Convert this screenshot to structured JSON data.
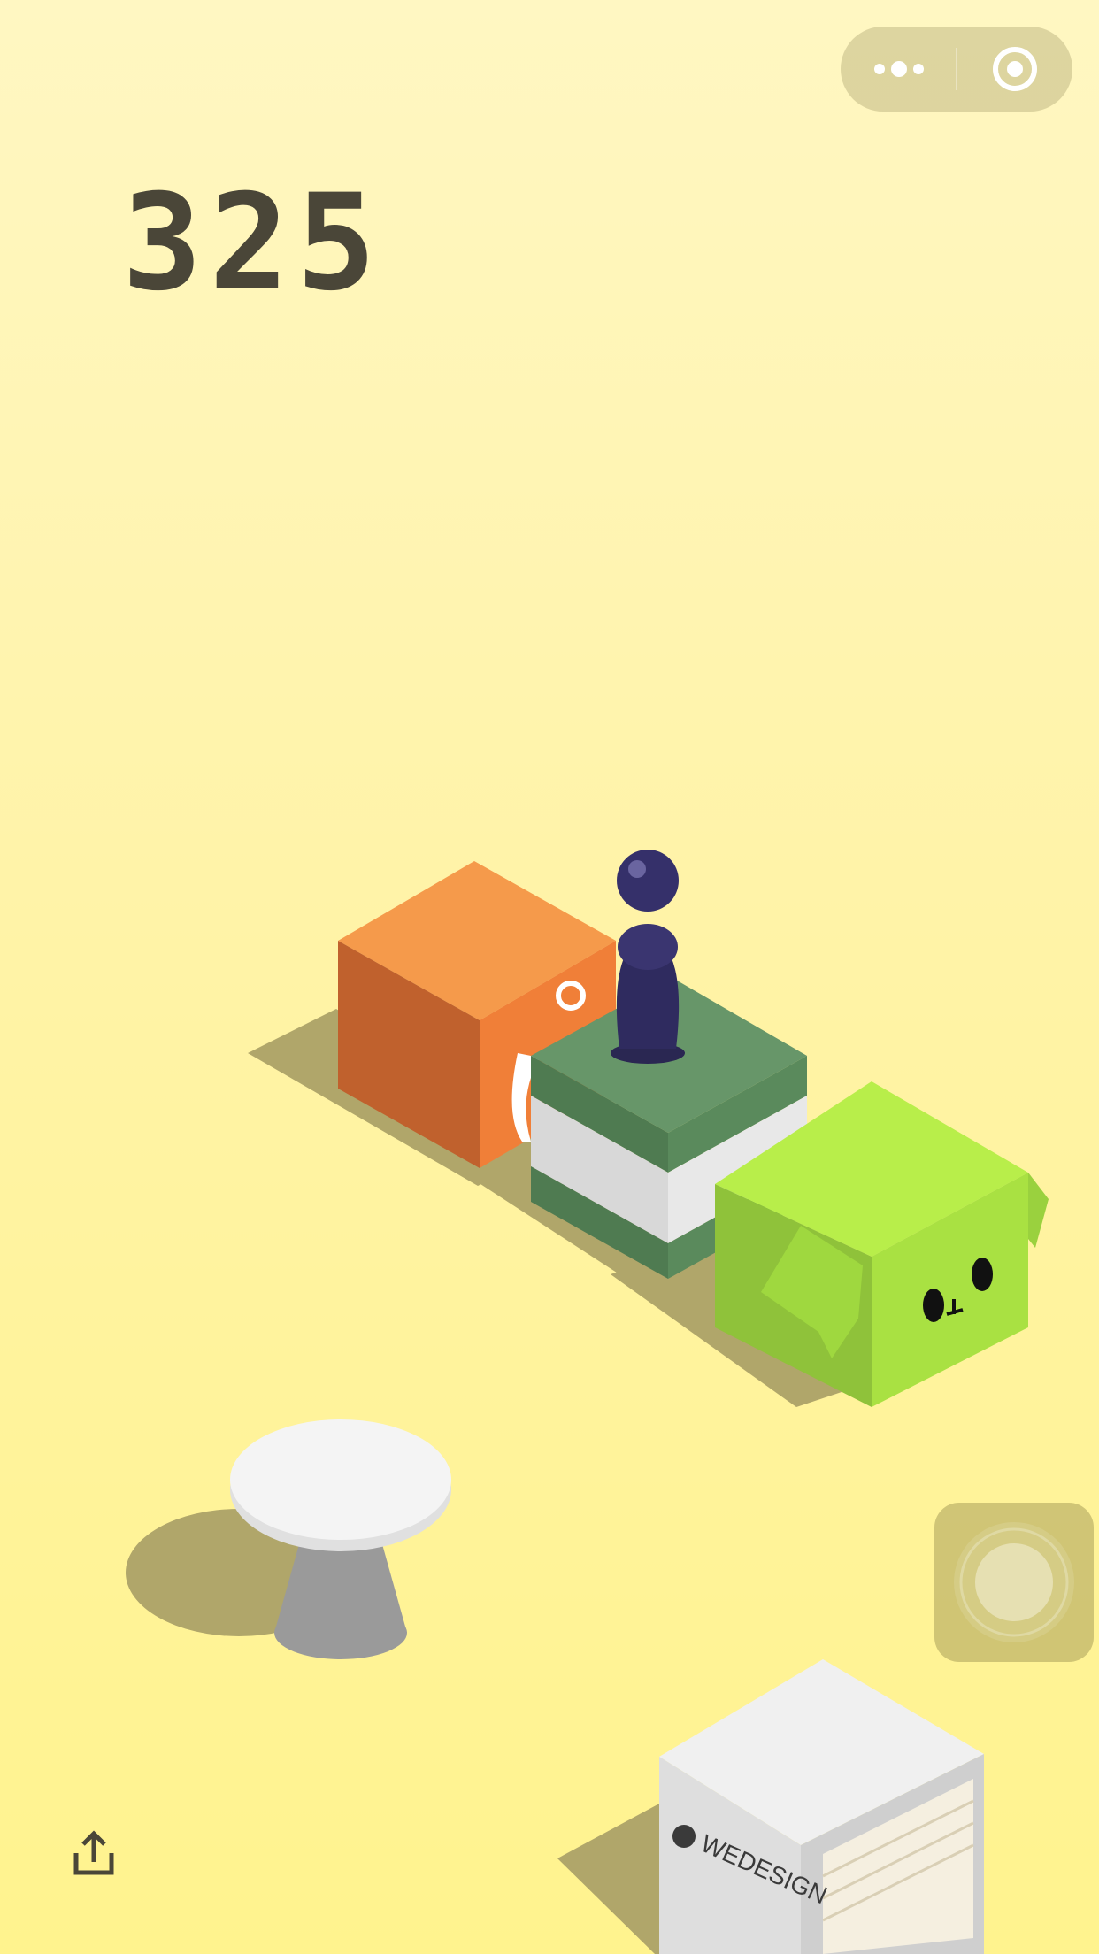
{
  "game": {
    "score": "325"
  },
  "top_capsule": {
    "more_icon": "more-dots-icon",
    "close_icon": "target-close-icon"
  },
  "bottom": {
    "share_icon": "share-icon"
  },
  "blocks": {
    "wedesign_label": "WEDESIGN"
  },
  "colors": {
    "background": "#fff3a8",
    "score": "#4a4638",
    "orange_block": "#f07f38",
    "green_block": "#5f8f5f",
    "lime_block": "#b4e647",
    "player": "#2f2b5f"
  }
}
